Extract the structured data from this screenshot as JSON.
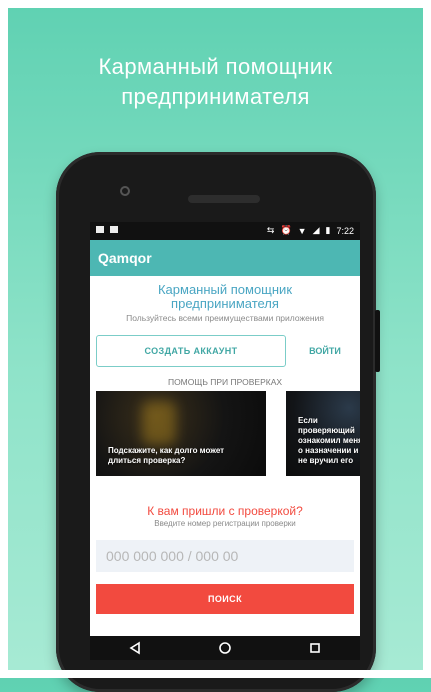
{
  "promo": {
    "line1": "Карманный помощник",
    "line2": "предпринимателя"
  },
  "status_bar": {
    "time": "7:22"
  },
  "app_bar": {
    "title": "Qamqor"
  },
  "hero": {
    "title_line1": "Карманный помощник",
    "title_line2": "предпринимателя",
    "subtitle": "Пользуйтесь всеми преимуществами приложения"
  },
  "auth": {
    "create_account": "СОЗДАТЬ АККАУНТ",
    "login": "ВОЙТИ"
  },
  "help_section": {
    "heading": "ПОМОЩЬ ПРИ ПРОВЕРКАХ",
    "cards": [
      {
        "text": "Подскажите, как долго может длиться проверка?"
      },
      {
        "text": "Если проверяющий ознакомил меня о назначении и не вручил его"
      }
    ]
  },
  "inspection": {
    "title": "К вам пришли с проверкой?",
    "subtitle": "Введите номер регистрации проверки",
    "input_placeholder": "000 000 000 / 000 00",
    "search_button": "ПОИСК"
  },
  "colors": {
    "background_green": "#5fd1b2",
    "app_bar": "#4db7b3",
    "accent_teal": "#41a7a4",
    "accent_red": "#f24a3f"
  },
  "icons": {
    "status_left": [
      "image-icon",
      "notification-icon"
    ],
    "status_right": [
      "sync-icon",
      "alarm-icon",
      "wifi-icon",
      "signal-icon",
      "battery-icon"
    ],
    "nav": [
      "back-icon",
      "home-icon",
      "recents-icon"
    ]
  }
}
